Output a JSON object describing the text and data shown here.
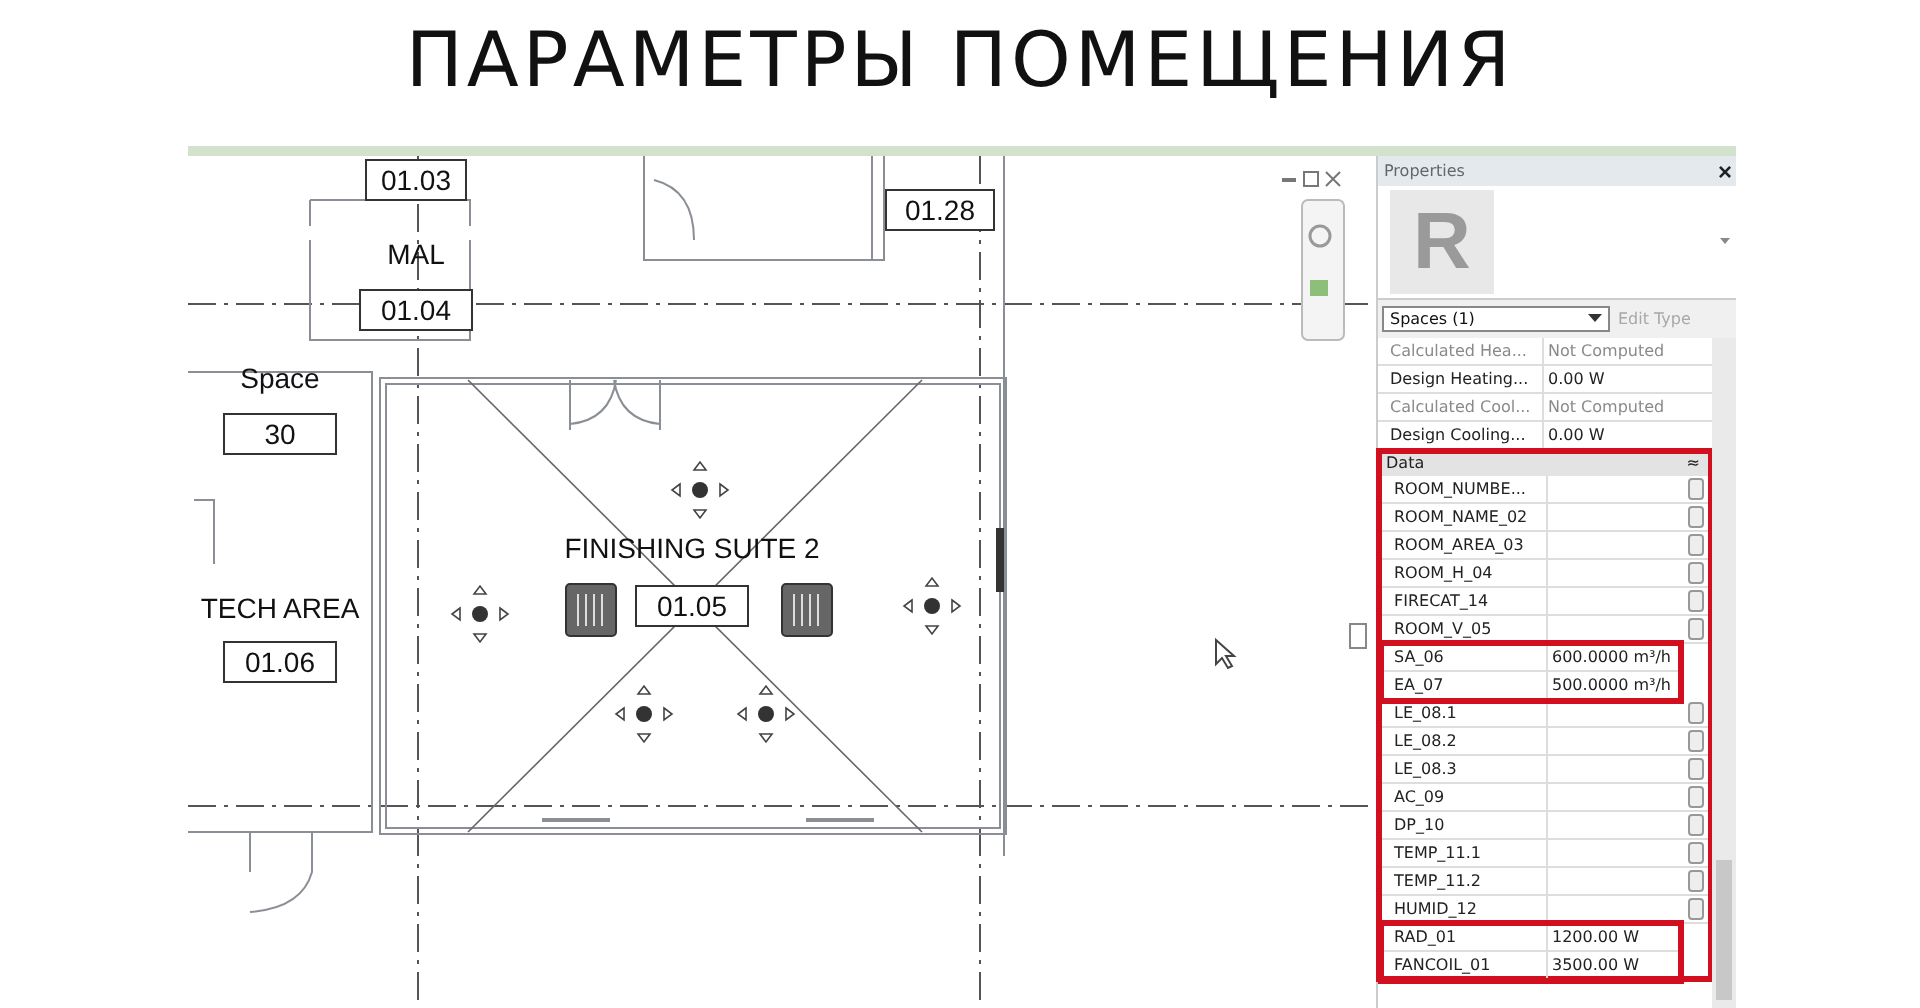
{
  "slide_title": "ПАРАМЕТРЫ ПОМЕЩЕНИЯ",
  "plan": {
    "rooms": [
      {
        "number": "01.03"
      },
      {
        "name": "MAL",
        "number": "01.04"
      },
      {
        "name": "Space",
        "number": "30"
      },
      {
        "name": "TECH AREA",
        "number": "01.06"
      },
      {
        "name": "FINISHING SUITE 2",
        "number": "01.05"
      },
      {
        "number": "01.28"
      }
    ]
  },
  "properties": {
    "title": "Properties",
    "close": "×",
    "type_logo": "R",
    "selector": "Spaces (1)",
    "edit_type": {
      "label": "Edit Type",
      "disabled": true
    },
    "rows": [
      {
        "name": "Calculated Hea...",
        "value": "Not Computed",
        "disabled": true
      },
      {
        "name": "Design Heating...",
        "value": "0.00 W",
        "disabled": false
      },
      {
        "name": "Calculated Cool...",
        "value": "Not Computed",
        "disabled": true
      },
      {
        "name": "Design Cooling...",
        "value": "0.00 W",
        "disabled": false
      }
    ],
    "data_section": {
      "label": "Data",
      "collapse": "≈",
      "outlined": true,
      "rows": [
        {
          "name": "ROOM_NUMBE...",
          "value": "",
          "highlighted": false
        },
        {
          "name": "ROOM_NAME_02",
          "value": "",
          "highlighted": false
        },
        {
          "name": "ROOM_AREA_03",
          "value": "",
          "highlighted": false
        },
        {
          "name": "ROOM_H_04",
          "value": "",
          "highlighted": false
        },
        {
          "name": "FIRECAT_14",
          "value": "",
          "highlighted": false
        },
        {
          "name": "ROOM_V_05",
          "value": "",
          "highlighted": false
        },
        {
          "name": "SA_06",
          "value": "600.0000 m³/h",
          "highlighted": true
        },
        {
          "name": "EA_07",
          "value": "500.0000 m³/h",
          "highlighted": true
        },
        {
          "name": "LE_08.1",
          "value": "",
          "highlighted": false
        },
        {
          "name": "LE_08.2",
          "value": "",
          "highlighted": false
        },
        {
          "name": "LE_08.3",
          "value": "",
          "highlighted": false
        },
        {
          "name": "AC_09",
          "value": "",
          "highlighted": false
        },
        {
          "name": "DP_10",
          "value": "",
          "highlighted": false
        },
        {
          "name": "TEMP_11.1",
          "value": "",
          "highlighted": false
        },
        {
          "name": "TEMP_11.2",
          "value": "",
          "highlighted": false
        },
        {
          "name": "HUMID_12",
          "value": "",
          "highlighted": false
        },
        {
          "name": "RAD_01",
          "value": "1200.00 W",
          "highlighted": true
        },
        {
          "name": "FANCOIL_01",
          "value": "3500.00 W",
          "highlighted": true
        }
      ]
    }
  }
}
